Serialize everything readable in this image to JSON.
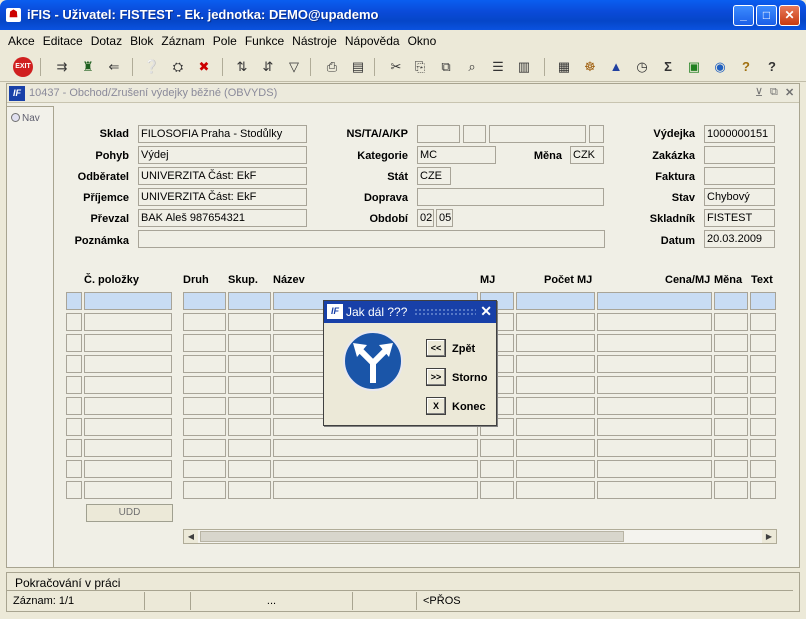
{
  "window": {
    "title": "iFIS - Uživatel: FISTEST - Ek. jednotka: DEMO@upademo"
  },
  "menu": [
    "Akce",
    "Editace",
    "Dotaz",
    "Blok",
    "Záznam",
    "Pole",
    "Funkce",
    "Nástroje",
    "Nápověda",
    "Okno"
  ],
  "mdi": {
    "title": "10437 - Obchod/Zrušení výdejky běžné (OBVYDS)",
    "icon": "IF"
  },
  "nav": {
    "label": "Nav"
  },
  "form": {
    "sklad_label": "Sklad",
    "sklad": "FILOSOFIA Praha - Stodůlky",
    "pohyb_label": "Pohyb",
    "pohyb": "Výdej",
    "odberatel_label": "Odběratel",
    "odberatel": "UNIVERZITA Část: EkF",
    "prijemce_label": "Příjemce",
    "prijemce": "UNIVERZITA Část: EkF",
    "prevzal_label": "Převzal",
    "prevzal": "BAK Aleš 987654321",
    "poznamka_label": "Poznámka",
    "poznamka": "",
    "ns_label": "NS/TA/A/KP",
    "kategorie_label": "Kategorie",
    "kategorie": "MC",
    "mena_label": "Měna",
    "mena": "CZK",
    "stat_label": "Stát",
    "stat": "CZE",
    "doprava_label": "Doprava",
    "doprava": "",
    "obdobi_label": "Období",
    "obdobi_1": "02",
    "obdobi_2": "05",
    "vydejka_label": "Výdejka",
    "vydejka": "1000000151",
    "zakazka_label": "Zakázka",
    "zakazka": "",
    "faktura_label": "Faktura",
    "faktura": "",
    "stav_label": "Stav",
    "stav": "Chybový",
    "skladnik_label": "Skladník",
    "skladnik": "FISTEST",
    "datum_label": "Datum",
    "datum": "20.03.2009"
  },
  "table": {
    "columns": [
      "Č. položky",
      "Druh",
      "Skup.",
      "Název",
      "MJ",
      "Počet MJ",
      "Cena/MJ",
      "Měna",
      "Text"
    ],
    "rows": 10
  },
  "udd_label": "UDD",
  "status": {
    "message": "Pokračování v práci",
    "record": "Záznam: 1/1",
    "dots": "...",
    "mode": "<PŘOS"
  },
  "dialog": {
    "title": "Jak dál ???",
    "buttons": [
      {
        "key": "<<",
        "label": "Zpět"
      },
      {
        "key": ">>",
        "label": "Storno"
      },
      {
        "key": "X",
        "label": "Konec"
      }
    ]
  }
}
